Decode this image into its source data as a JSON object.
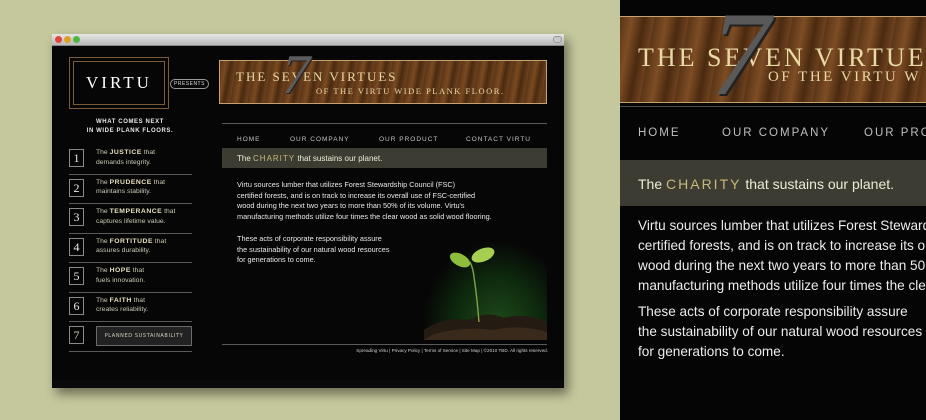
{
  "site": {
    "logo": "VIRTU",
    "presents": "PRESENTS",
    "banner_line1": "THE SEVEN VIRTUES",
    "banner_line2": "OF THE VIRTU WIDE PLANK FLOOR.",
    "banner_number": "7",
    "sidebar_heading_line1": "WHAT COMES NEXT",
    "sidebar_heading_line2": "IN WIDE PLANK FLOORS.",
    "virtues": [
      {
        "num": "1",
        "prefix": "The ",
        "name": "JUSTICE",
        "suffix": " that",
        "line2": "demands integrity."
      },
      {
        "num": "2",
        "prefix": "The ",
        "name": "PRUDENCE",
        "suffix": " that",
        "line2": "maintains stability."
      },
      {
        "num": "3",
        "prefix": "The ",
        "name": "TEMPERANCE",
        "suffix": " that",
        "line2": "captures lifetime value."
      },
      {
        "num": "4",
        "prefix": "The ",
        "name": "FORTITUDE",
        "suffix": " that",
        "line2": "assures durability."
      },
      {
        "num": "5",
        "prefix": "The ",
        "name": "HOPE",
        "suffix": " that",
        "line2": "fuels innovation."
      },
      {
        "num": "6",
        "prefix": "The ",
        "name": "FAITH",
        "suffix": " that",
        "line2": "creates reliability."
      }
    ],
    "virtue7": {
      "num": "7",
      "label": "PLANNED SUSTAINABILITY"
    },
    "nav": [
      "HOME",
      "OUR COMPANY",
      "OUR PRODUCT",
      "CONTACT VIRTU"
    ],
    "heading_prefix": "The ",
    "heading_highlight": "CHARITY",
    "heading_suffix": " that sustains our planet.",
    "para1_lines": [
      "Virtu sources lumber that utilizes Forest Stewardship Council (FSC)",
      "certified forests, and is on track to increase its overall use of FSC-certified",
      "wood during the next two years to more than 50% of its volume. Virtu's",
      "manufacturing methods utilize four times the clear wood as solid wood flooring."
    ],
    "para2_lines": [
      "These acts of corporate responsibility assure",
      "the sustainability of our natural wood resources",
      "for generations to come."
    ],
    "footer": "Spreading Virtu  |  Privacy Policy  |  Terms of Service  |  Site Map  |  ©2010 TBD. All rights reserved."
  },
  "zoom": {
    "banner_line1": "THE SEVEN VIRTUES",
    "banner_line2": "OF THE VIRTU W",
    "banner_number": "7",
    "nav": [
      "HOME",
      "OUR COMPANY",
      "OUR PRO"
    ],
    "heading_prefix": "The ",
    "heading_highlight": "CHARITY",
    "heading_suffix": " that sustains our planet.",
    "para1_lines": [
      "Virtu sources lumber that utilizes Forest Steward",
      "certified forests, and is on track to increase its o",
      "wood during the next two years to more than 50",
      "manufacturing methods utilize four times the cle"
    ],
    "para2_lines": [
      "These acts of corporate responsibility assure",
      "the sustainability of our natural wood resources",
      "for generations to come."
    ]
  },
  "colors": {
    "background": "#c5c79c",
    "page": "#060606",
    "highlight": "#c7b978",
    "wood": "#6e4220"
  }
}
